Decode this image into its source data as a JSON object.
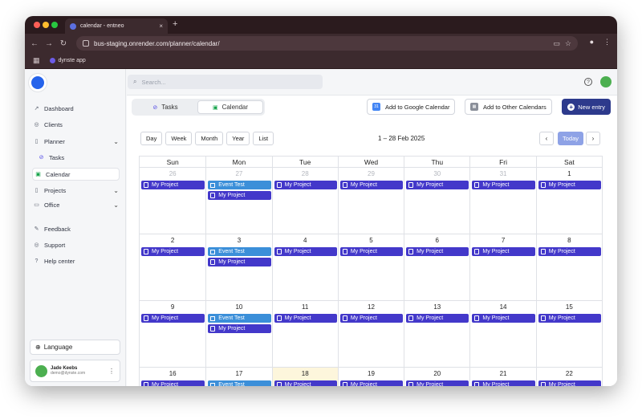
{
  "browser": {
    "tab_title": "calendar - entneo",
    "tab_close": "×",
    "new_tab": "+",
    "url": "bus-staging.onrender.com/planner/calendar/",
    "bookmark": "dynste app"
  },
  "search": {
    "placeholder": "Search..."
  },
  "sidebar": {
    "items": [
      {
        "label": "Dashboard",
        "icon": "chart-icon"
      },
      {
        "label": "Clients",
        "icon": "user-icon"
      },
      {
        "label": "Planner",
        "icon": "doc-icon"
      },
      {
        "label": "Tasks",
        "icon": "check-circle-icon"
      },
      {
        "label": "Calendar",
        "icon": "calendar-icon"
      },
      {
        "label": "Projects",
        "icon": "doc-icon"
      },
      {
        "label": "Office",
        "icon": "folder-icon"
      },
      {
        "label": "Feedback",
        "icon": "edit-icon"
      },
      {
        "label": "Support",
        "icon": "life-ring-icon"
      },
      {
        "label": "Help center",
        "icon": "help-icon"
      }
    ],
    "language": "Language",
    "user": {
      "name": "Jade Keebs",
      "email": "demo@dynste.com"
    }
  },
  "view_toggle": {
    "tasks": "Tasks",
    "calendar": "Calendar"
  },
  "buttons": {
    "google": "Add to Google Calendar",
    "other": "Add to Other Calendars",
    "new_entry": "New entry"
  },
  "calendar": {
    "views": [
      "Day",
      "Week",
      "Month",
      "Year",
      "List"
    ],
    "range": "1 – 28 Feb 2025",
    "today": "Today",
    "prev": "‹",
    "next": "›",
    "weekdays": [
      "Sun",
      "Mon",
      "Tue",
      "Wed",
      "Thu",
      "Fri",
      "Sat"
    ],
    "weeks": [
      {
        "days": [
          {
            "num": "26",
            "other": true,
            "events": [
              "My Project"
            ]
          },
          {
            "num": "27",
            "other": true,
            "events": [
              "Event Test",
              "My Project"
            ]
          },
          {
            "num": "28",
            "other": true,
            "events": [
              "My Project"
            ]
          },
          {
            "num": "29",
            "other": true,
            "events": [
              "My Project"
            ]
          },
          {
            "num": "30",
            "other": true,
            "events": [
              "My Project"
            ]
          },
          {
            "num": "31",
            "other": true,
            "events": [
              "My Project"
            ]
          },
          {
            "num": "1",
            "events": [
              "My Project"
            ]
          }
        ]
      },
      {
        "days": [
          {
            "num": "2",
            "events": [
              "My Project"
            ]
          },
          {
            "num": "3",
            "events": [
              "Event Test",
              "My Project"
            ]
          },
          {
            "num": "4",
            "events": [
              "My Project"
            ]
          },
          {
            "num": "5",
            "events": [
              "My Project"
            ]
          },
          {
            "num": "6",
            "events": [
              "My Project"
            ]
          },
          {
            "num": "7",
            "events": [
              "My Project"
            ]
          },
          {
            "num": "8",
            "events": [
              "My Project"
            ]
          }
        ]
      },
      {
        "days": [
          {
            "num": "9",
            "events": [
              "My Project"
            ]
          },
          {
            "num": "10",
            "events": [
              "Event Test",
              "My Project"
            ]
          },
          {
            "num": "11",
            "events": [
              "My Project"
            ]
          },
          {
            "num": "12",
            "events": [
              "My Project"
            ]
          },
          {
            "num": "13",
            "events": [
              "My Project"
            ]
          },
          {
            "num": "14",
            "events": [
              "My Project"
            ]
          },
          {
            "num": "15",
            "events": [
              "My Project"
            ]
          }
        ]
      },
      {
        "days": [
          {
            "num": "16",
            "events": [
              "My Project"
            ]
          },
          {
            "num": "17",
            "events": [
              "Event Test"
            ]
          },
          {
            "num": "18",
            "today": true,
            "events": [
              "My Project"
            ]
          },
          {
            "num": "19",
            "events": [
              "My Project"
            ]
          },
          {
            "num": "20",
            "events": [
              "My Project"
            ]
          },
          {
            "num": "21",
            "events": [
              "My Project"
            ]
          },
          {
            "num": "22",
            "events": [
              "My Project"
            ]
          }
        ]
      }
    ]
  },
  "colors": {
    "project_event": "#4338ca",
    "test_event": "#3b8fd9",
    "new_entry_button": "#2d3a8c",
    "today_button": "#8ea2e6",
    "today_cell": "#fdf6dc"
  }
}
